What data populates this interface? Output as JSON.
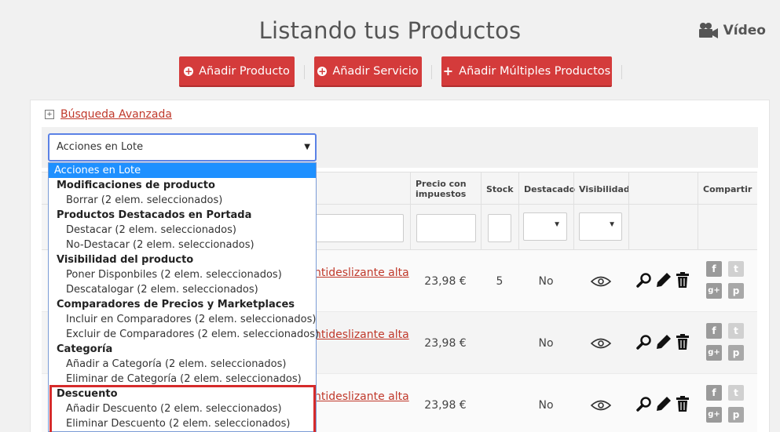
{
  "page": {
    "title": "Listando tus Productos",
    "video_label": "Vídeo"
  },
  "toolbar": {
    "add_product": "Añadir Producto",
    "add_service": "Añadir Servicio",
    "add_multiple": "Añadir Múltiples Productos"
  },
  "search": {
    "toggle": "+",
    "advanced_label": "Búsqueda Avanzada"
  },
  "bulk": {
    "selected_value": "Acciones en Lote",
    "options": [
      {
        "type": "selected",
        "label": "Acciones en Lote"
      },
      {
        "type": "group",
        "label": "Modificaciones de producto"
      },
      {
        "type": "option",
        "label": "Borrar (2 elem. seleccionados)"
      },
      {
        "type": "group",
        "label": "Productos Destacados en Portada"
      },
      {
        "type": "option",
        "label": "Destacar (2 elem. seleccionados)"
      },
      {
        "type": "option",
        "label": "No-Destacar (2 elem. seleccionados)"
      },
      {
        "type": "group",
        "label": "Visibilidad del producto"
      },
      {
        "type": "option",
        "label": "Poner Disponbiles (2 elem. seleccionados)"
      },
      {
        "type": "option",
        "label": "Descatalogar (2 elem. seleccionados)"
      },
      {
        "type": "group",
        "label": "Comparadores de Precios y Marketplaces"
      },
      {
        "type": "option",
        "label": "Incluir en Comparadores (2 elem. seleccionados)"
      },
      {
        "type": "option",
        "label": "Excluir de Comparadores (2 elem. seleccionados)"
      },
      {
        "type": "group",
        "label": "Categoría"
      },
      {
        "type": "option",
        "label": "Añadir a Categoría (2 elem. seleccionados)"
      },
      {
        "type": "option",
        "label": "Eliminar de Categoría (2 elem. seleccionados)"
      },
      {
        "type": "group",
        "label": "Descuento"
      },
      {
        "type": "option",
        "label": "Añadir Descuento (2 elem. seleccionados)"
      },
      {
        "type": "option",
        "label": "Eliminar Descuento (2 elem. seleccionados)"
      }
    ]
  },
  "table": {
    "headers": {
      "price_line1": "Precio con",
      "price_line2": "impuestos",
      "stock": "Stock",
      "featured": "Destacado",
      "visibility": "Visibilidad",
      "share": "Compartir"
    },
    "rows": [
      {
        "name": "ntideslizante alta",
        "price": "23,98 €",
        "stock": "5",
        "featured": "No"
      },
      {
        "name": "ntideslizante alta",
        "price": "23,98 €",
        "stock": "",
        "featured": "No"
      },
      {
        "name": "ntideslizante alta",
        "price": "23,98 €",
        "stock": "",
        "featured": "No"
      }
    ]
  },
  "share_icons": {
    "facebook": "f",
    "twitter": "t",
    "google": "g+",
    "pinterest": "p"
  },
  "colors": {
    "brand_red": "#d43b3b",
    "link_red": "#c0392b",
    "select_blue": "#1e90ff",
    "highlight_red": "#d62b2b"
  },
  "icons": [
    "video-camera-icon",
    "plus-circle-icon",
    "plus-icon",
    "expand-icon",
    "chevron-down-icon",
    "eye-icon",
    "search-icon",
    "pencil-icon",
    "trash-icon",
    "facebook-icon",
    "twitter-icon",
    "google-plus-icon",
    "pinterest-icon"
  ]
}
